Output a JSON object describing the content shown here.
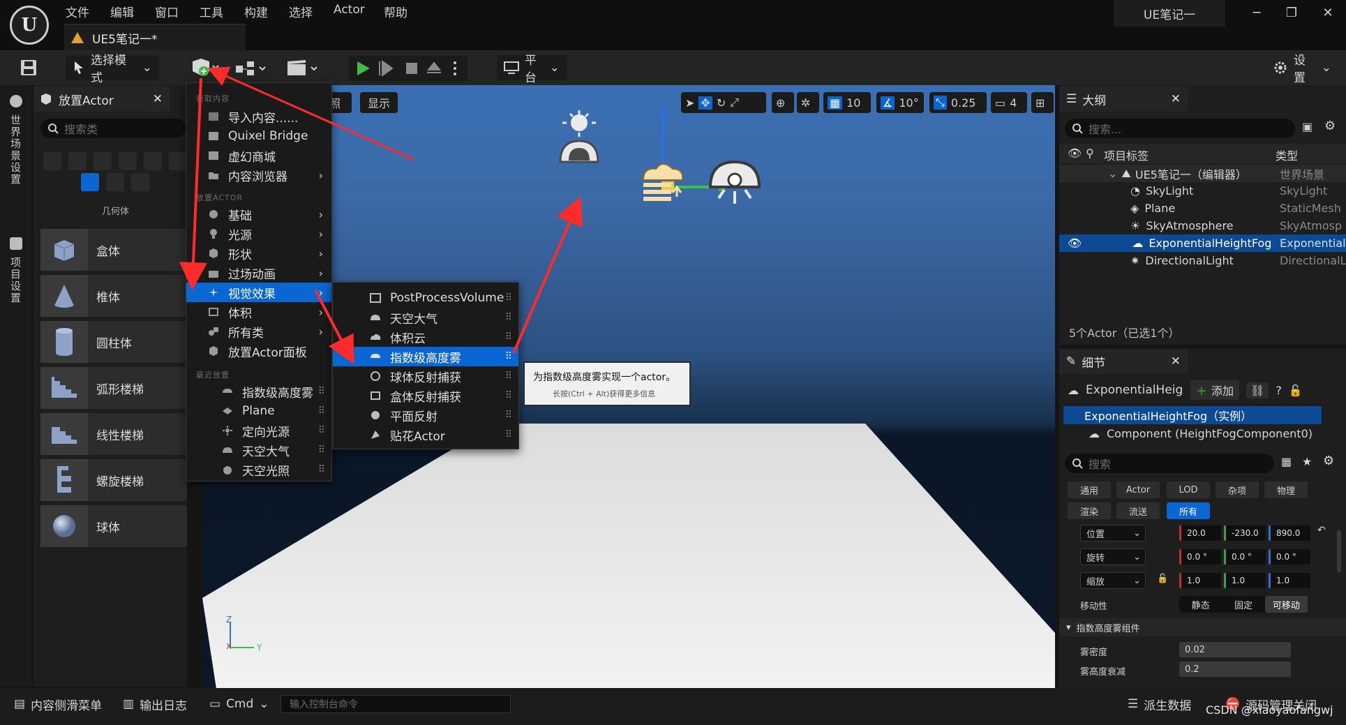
{
  "app": {
    "menu": [
      "文件",
      "编辑",
      "窗口",
      "工具",
      "构建",
      "选择",
      "Actor",
      "帮助"
    ],
    "doc_tab": "UE5笔记一*",
    "project": "UE笔记一"
  },
  "toolbar": {
    "select_mode": "选择模式",
    "platform": "平台",
    "settings": "设置"
  },
  "left_strip": {
    "world_settings": "世界场景设置",
    "project_settings": "项目设置"
  },
  "place_actors": {
    "tab": "放置Actor",
    "search_placeholder": "搜索类",
    "category": "几何体",
    "items": [
      "盒体",
      "椎体",
      "圆柱体",
      "弧形楼梯",
      "线性楼梯",
      "螺旋楼梯",
      "球体"
    ]
  },
  "viewport": {
    "btn_lit_partial": "照",
    "btn_show": "显示",
    "grid_snap": "10",
    "rot_snap": "10°",
    "scale_snap": "0.25",
    "camera_speed": "4"
  },
  "quick_add_menu": {
    "sec_get_content": "获取内容",
    "sec_place_actor": "放置ACTOR",
    "sec_recent": "最近放置",
    "items": [
      "导入内容......",
      "Quixel Bridge",
      "虚幻商城",
      "内容浏览器",
      "基础",
      "光源",
      "形状",
      "过场动画",
      "视觉效果",
      "体积",
      "所有类",
      "放置Actor面板"
    ],
    "recent": [
      "指数级高度雾",
      "Plane",
      "定向光源",
      "天空大气",
      "天空光照"
    ]
  },
  "visual_effects_menu": {
    "items": [
      "PostProcessVolume",
      "天空大气",
      "体积云",
      "指数级高度雾",
      "球体反射捕获",
      "盒体反射捕获",
      "平面反射",
      "贴花Actor"
    ]
  },
  "tooltip": {
    "title": "为指数级高度雾实现一个actor。",
    "hint": "长按(Ctrl + Alt)获得更多信息"
  },
  "outliner": {
    "tab": "大纲",
    "search_placeholder": "搜索...",
    "col_label": "项目标签",
    "col_type": "类型",
    "rows": [
      {
        "label": "UE5笔记一（编辑器）",
        "type": "世界场景"
      },
      {
        "label": "SkyLight",
        "type": "SkyLight"
      },
      {
        "label": "Plane",
        "type": "StaticMesh"
      },
      {
        "label": "SkyAtmosphere",
        "type": "SkyAtmosp"
      },
      {
        "label": "ExponentialHeightFog",
        "type": "Exponential"
      },
      {
        "label": "DirectionalLight",
        "type": "DirectionalL"
      }
    ],
    "status": "5个Actor（已选1个）"
  },
  "details": {
    "tab": "细节",
    "actor_name": "ExponentialHeigh",
    "add_label": "添加",
    "instance": "ExponentialHeightFog（实例）",
    "component": "Component (HeightFogComponent0)",
    "search_placeholder": "搜索",
    "filter_tabs": [
      "通用",
      "Actor",
      "LOD",
      "杂项",
      "物理",
      "渲染",
      "流送",
      "所有"
    ],
    "location_label": "位置",
    "rotation_label": "旋转",
    "scale_label": "缩放",
    "location": [
      "20.0",
      "-230.0",
      "890.0"
    ],
    "rotation": [
      "0.0 °",
      "0.0 °",
      "0.0 °"
    ],
    "scale": [
      "1.0",
      "1.0",
      "1.0"
    ],
    "mobility_label": "移动性",
    "mobility": [
      "静态",
      "固定",
      "可移动"
    ],
    "section": "指数高度雾组件",
    "fog_density_label": "雾密度",
    "fog_density": "0.02",
    "fog_falloff_label": "雾高度衰减",
    "fog_falloff": "0.2"
  },
  "bottom": {
    "content_drawer": "内容侧滑菜单",
    "output_log": "输出日志",
    "cmd": "Cmd",
    "console_placeholder": "输入控制台命令",
    "derived_data": "派生数据",
    "source_control": "源码管理关闭",
    "watermark": "CSDN @xiaoyaofangwj"
  },
  "colors": {
    "accent": "#0a66d2",
    "arrow": "#ff2a2a",
    "play": "#3fbf3f"
  }
}
